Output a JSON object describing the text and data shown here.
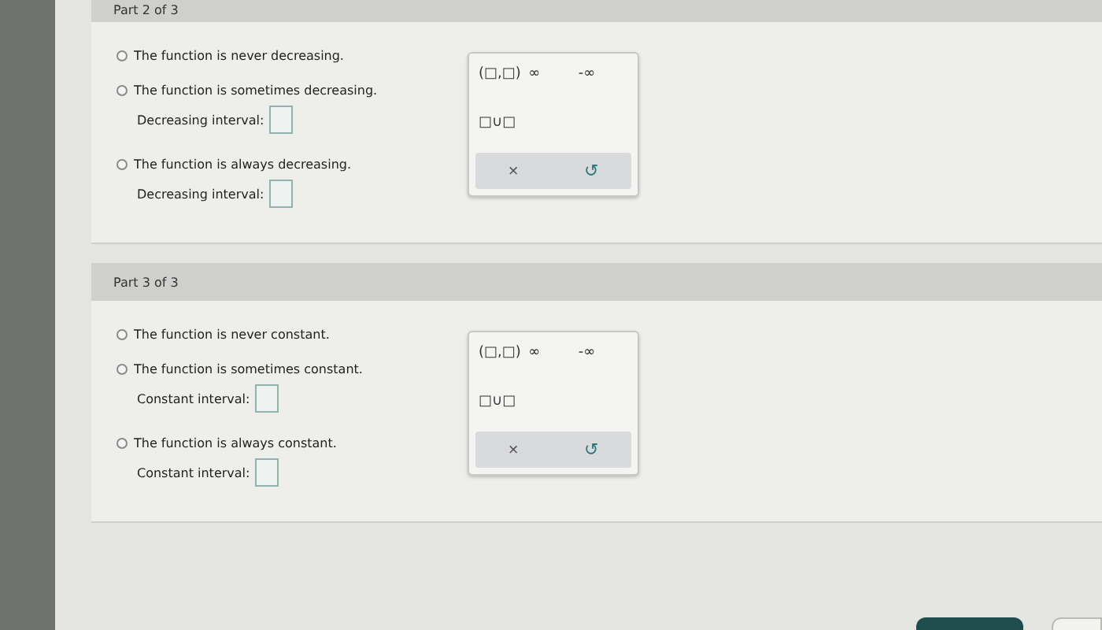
{
  "parts": [
    {
      "header": "Part 2 of 3",
      "options": [
        {
          "label": "The function is never decreasing.",
          "selected": false
        },
        {
          "label": "The function is sometimes decreasing.",
          "selected": false,
          "field_label": "Decreasing interval:"
        },
        {
          "label": "The function is always decreasing.",
          "selected": false,
          "field_label": "Decreasing interval:"
        }
      ],
      "palette": {
        "keys": [
          "(□,□)",
          "∞",
          "-∞",
          "□∪□"
        ],
        "actions": [
          "×",
          "↺"
        ]
      }
    },
    {
      "header": "Part 3 of 3",
      "options": [
        {
          "label": "The function is never constant.",
          "selected": false
        },
        {
          "label": "The function is sometimes constant.",
          "selected": false,
          "field_label": "Constant interval:"
        },
        {
          "label": "The function is always constant.",
          "selected": false,
          "field_label": "Constant interval:"
        }
      ],
      "palette": {
        "keys": [
          "(□,□)",
          "∞",
          "-∞",
          "□∪□"
        ],
        "actions": [
          "×",
          "↺"
        ]
      }
    }
  ]
}
